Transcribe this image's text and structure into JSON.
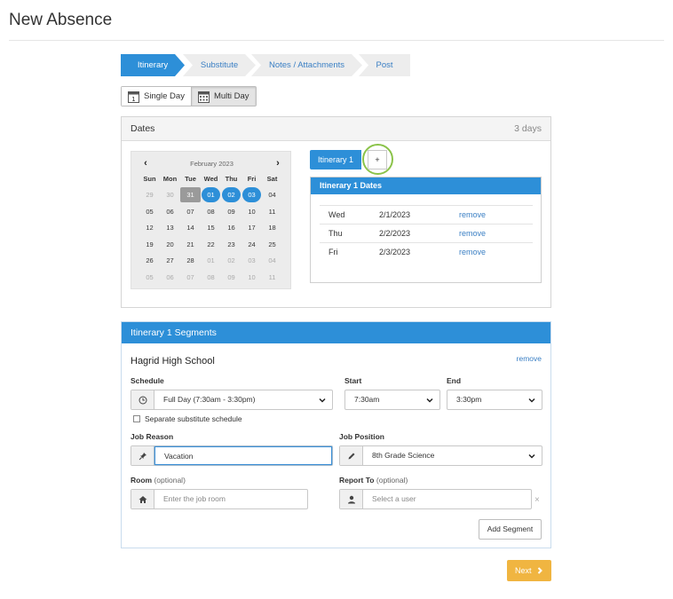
{
  "page": {
    "title": "New Absence"
  },
  "wizard": {
    "steps": [
      {
        "label": "Itinerary",
        "active": true
      },
      {
        "label": "Substitute",
        "active": false
      },
      {
        "label": "Notes / Attachments",
        "active": false
      },
      {
        "label": "Post",
        "active": false
      }
    ]
  },
  "day_mode": {
    "single_label": "Single Day",
    "multi_label": "Multi Day",
    "selected": "Multi Day",
    "single_icon": "1",
    "multi_icon": "calendar-grid-icon"
  },
  "dates": {
    "title": "Dates",
    "count": "3 days",
    "calendar": {
      "month": "February 2023",
      "prev_icon": "chevron-left-icon",
      "next_icon": "chevron-right-icon",
      "dow": [
        "Sun",
        "Mon",
        "Tue",
        "Wed",
        "Thu",
        "Fri",
        "Sat"
      ],
      "days": [
        [
          "29",
          "30",
          "31",
          "01",
          "02",
          "03",
          "04"
        ],
        [
          "05",
          "06",
          "07",
          "08",
          "09",
          "10",
          "11"
        ],
        [
          "12",
          "13",
          "14",
          "15",
          "16",
          "17",
          "18"
        ],
        [
          "19",
          "20",
          "21",
          "22",
          "23",
          "24",
          "25"
        ],
        [
          "26",
          "27",
          "28",
          "01",
          "02",
          "03",
          "04"
        ],
        [
          "05",
          "06",
          "07",
          "08",
          "09",
          "10",
          "11"
        ]
      ],
      "today": "31",
      "selected": [
        "01",
        "02",
        "03"
      ]
    },
    "itinerary_tab": "Itinerary 1",
    "add_label": "+",
    "itinerary_dates": {
      "title": "Itinerary 1 Dates",
      "rows": [
        {
          "day": "Wed",
          "date": "2/1/2023",
          "action": "remove"
        },
        {
          "day": "Thu",
          "date": "2/2/2023",
          "action": "remove"
        },
        {
          "day": "Fri",
          "date": "2/3/2023",
          "action": "remove"
        }
      ]
    }
  },
  "segments": {
    "title": "Itinerary 1 Segments",
    "school": "Hagrid High School",
    "remove_label": "remove",
    "schedule": {
      "label": "Schedule",
      "value": "Full Day (7:30am - 3:30pm)",
      "icon": "clock-icon"
    },
    "start": {
      "label": "Start",
      "value": "7:30am"
    },
    "end": {
      "label": "End",
      "value": "3:30pm"
    },
    "separate_schedule": "Separate substitute schedule",
    "job_reason": {
      "label": "Job Reason",
      "value": "Vacation",
      "icon": "pin-icon"
    },
    "job_position": {
      "label": "Job Position",
      "value": "8th Grade Science",
      "icon": "pencil-icon"
    },
    "room": {
      "label": "Room",
      "optional": "(optional)",
      "placeholder": "Enter the job room",
      "icon": "home-icon"
    },
    "report_to": {
      "label": "Report To",
      "optional": "(optional)",
      "placeholder": "Select a user",
      "icon": "user-icon",
      "clear": "×"
    },
    "add_segment": "Add Segment"
  },
  "footer": {
    "next_label": "Next",
    "next_icon": "chevron-right-icon"
  },
  "colors": {
    "primary": "#2d8fd8",
    "accent_ring": "#8bc34a",
    "next": "#f0b541"
  }
}
